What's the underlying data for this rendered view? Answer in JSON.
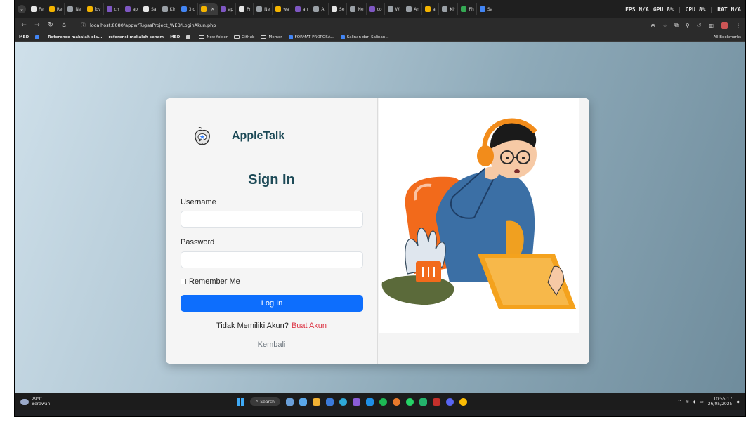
{
  "browser": {
    "tabs": [
      {
        "label": "Fe",
        "color": "#e6e6e6"
      },
      {
        "label": "Re",
        "color": "#f4b400"
      },
      {
        "label": "Ne",
        "color": "#9aa0a6"
      },
      {
        "label": "lov",
        "color": "#f4b400"
      },
      {
        "label": "ch",
        "color": "#7e57c2"
      },
      {
        "label": "ap",
        "color": "#7e57c2"
      },
      {
        "label": "Sa",
        "color": "#e6e6e6"
      },
      {
        "label": "Kir",
        "color": "#9aa0a6"
      },
      {
        "label": "3.c",
        "color": "#4285f4"
      },
      {
        "label": "",
        "color": "#f4b400"
      },
      {
        "label": "ap",
        "color": "#7e57c2"
      },
      {
        "label": "Pr",
        "color": "#e6e6e6"
      },
      {
        "label": "Ne",
        "color": "#9aa0a6"
      },
      {
        "label": "wa",
        "color": "#f4b400"
      },
      {
        "label": "an",
        "color": "#7e57c2"
      },
      {
        "label": "Ar",
        "color": "#9aa0a6"
      },
      {
        "label": "Se",
        "color": "#e6e6e6"
      },
      {
        "label": "Ne",
        "color": "#9aa0a6"
      },
      {
        "label": "co",
        "color": "#7e57c2"
      },
      {
        "label": "Wi",
        "color": "#9aa0a6"
      },
      {
        "label": "An",
        "color": "#9aa0a6"
      },
      {
        "label": "ai",
        "color": "#f4b400"
      },
      {
        "label": "Kir",
        "color": "#9aa0a6"
      },
      {
        "label": "Ph",
        "color": "#34a853"
      },
      {
        "label": "Sa",
        "color": "#4285f4"
      }
    ],
    "active_tab_index": 9,
    "perf": {
      "fps": "FPS N/A",
      "gpu": "GPU 8%",
      "cpu": "CPU 8%",
      "ram": "RAT N/A"
    },
    "url": "localhost:8080/appw/TugasProject_WEB/LoginAkun.php",
    "bookmarks": [
      {
        "label": "MBD",
        "type": "text"
      },
      {
        "label": "",
        "type": "icon"
      },
      {
        "label": "Reference makalah ola...",
        "type": "text"
      },
      {
        "label": "referensi makalah senam",
        "type": "text"
      },
      {
        "label": "MBD",
        "type": "text"
      },
      {
        "label": "",
        "type": "grid"
      },
      {
        "label": "New folder",
        "type": "folder"
      },
      {
        "label": "Github",
        "type": "folder"
      },
      {
        "label": "Memor",
        "type": "folder"
      },
      {
        "label": "FORMAT PROPOSA...",
        "type": "doc"
      },
      {
        "label": "Salinan dari Salinan...",
        "type": "doc"
      }
    ],
    "all_bookmarks": "All Bookmarks"
  },
  "login": {
    "brand": "AppleTalk",
    "title": "Sign In",
    "username_label": "Username",
    "username_value": "",
    "password_label": "Password",
    "password_value": "",
    "remember_label": "Remember Me",
    "login_button": "Log In",
    "no_account_text": "Tidak Memiliki Akun?",
    "create_account_link": "Buat Akun",
    "back_link": "Kembali"
  },
  "taskbar": {
    "temperature": "29°C",
    "weather": "Berawan",
    "search": "Search",
    "time": "10:55:17",
    "date": "26/05/2025"
  },
  "colors": {
    "accent": "#0d6efd",
    "brand_text": "#1d4a57",
    "link_red": "#dc3545"
  }
}
